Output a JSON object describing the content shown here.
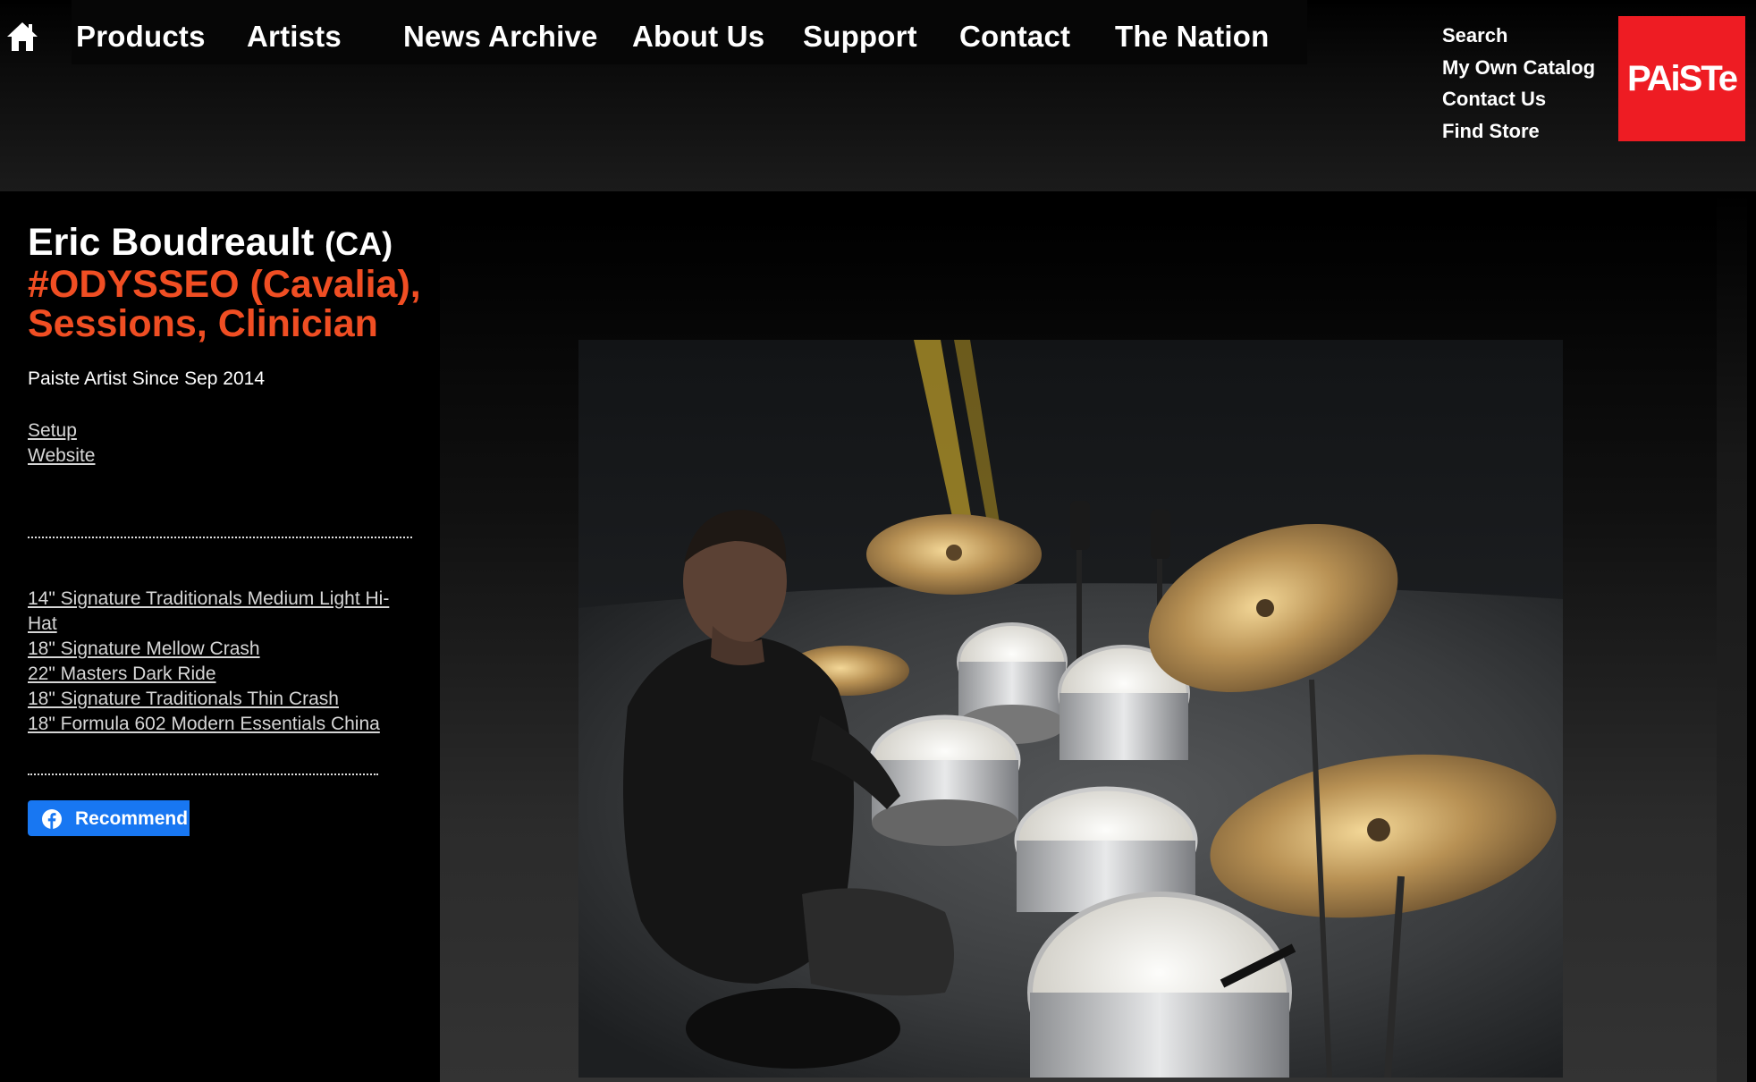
{
  "nav": {
    "home_icon": "home-icon",
    "items": [
      "Products",
      "Artists",
      "News Archive",
      "About Us",
      "Support",
      "Contact",
      "The Nation"
    ]
  },
  "side_links": [
    "Search",
    "My Own Catalog",
    "Contact Us",
    "Find Store"
  ],
  "logo": {
    "text": "PAiSTe",
    "color": "#ee1c23"
  },
  "artist": {
    "name": "Eric Boudreault",
    "country": "(CA)",
    "role": "#ODYSSEO (Cavalia), Sessions, Clinician",
    "since": "Paiste Artist Since Sep 2014",
    "links": [
      "Setup",
      "Website"
    ],
    "cymbals": [
      "14\" Signature Traditionals Medium Light Hi-Hat",
      "18\" Signature Mellow Crash",
      "22\" Masters Dark Ride",
      "18\" Signature Traditionals Thin Crash",
      "18\" Formula 602 Modern Essentials China"
    ]
  },
  "facebook": {
    "label": "Recommend",
    "icon": "facebook-icon",
    "color": "#1877f2"
  },
  "colors": {
    "accent": "#f04e23",
    "background": "#000000"
  }
}
